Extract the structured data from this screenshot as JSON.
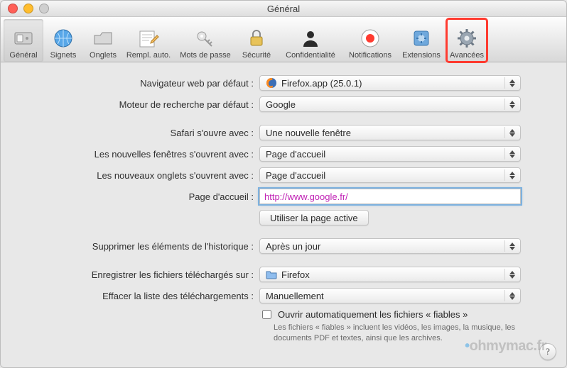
{
  "window": {
    "title": "Général"
  },
  "toolbar": {
    "items": [
      {
        "label": "Général"
      },
      {
        "label": "Signets"
      },
      {
        "label": "Onglets"
      },
      {
        "label": "Rempl. auto."
      },
      {
        "label": "Mots de passe"
      },
      {
        "label": "Sécurité"
      },
      {
        "label": "Confidentialité"
      },
      {
        "label": "Notifications"
      },
      {
        "label": "Extensions"
      },
      {
        "label": "Avancées"
      }
    ]
  },
  "form": {
    "default_browser_label": "Navigateur web par défaut :",
    "default_browser_value": "Firefox.app (25.0.1)",
    "default_search_label": "Moteur de recherche par défaut :",
    "default_search_value": "Google",
    "opens_with_label": "Safari s'ouvre avec :",
    "opens_with_value": "Une nouvelle fenêtre",
    "new_windows_label": "Les nouvelles fenêtres s'ouvrent avec :",
    "new_windows_value": "Page d'accueil",
    "new_tabs_label": "Les nouveaux onglets s'ouvrent avec :",
    "new_tabs_value": "Page d'accueil",
    "homepage_label": "Page d'accueil :",
    "homepage_value": "http://www.google.fr/",
    "use_current_page_btn": "Utiliser la page active",
    "history_label": "Supprimer les éléments de l'historique :",
    "history_value": "Après un jour",
    "downloads_label": "Enregistrer les fichiers téléchargés sur :",
    "downloads_value": "Firefox",
    "clear_downloads_label": "Effacer la liste des téléchargements :",
    "clear_downloads_value": "Manuellement",
    "safe_open_label": "Ouvrir automatiquement les fichiers « fiables »",
    "safe_open_sub": "Les fichiers « fiables » incluent les vidéos, les images, la musique, les documents PDF et textes, ainsi que les archives."
  },
  "watermark": "ohmymac.fr",
  "help_glyph": "?"
}
